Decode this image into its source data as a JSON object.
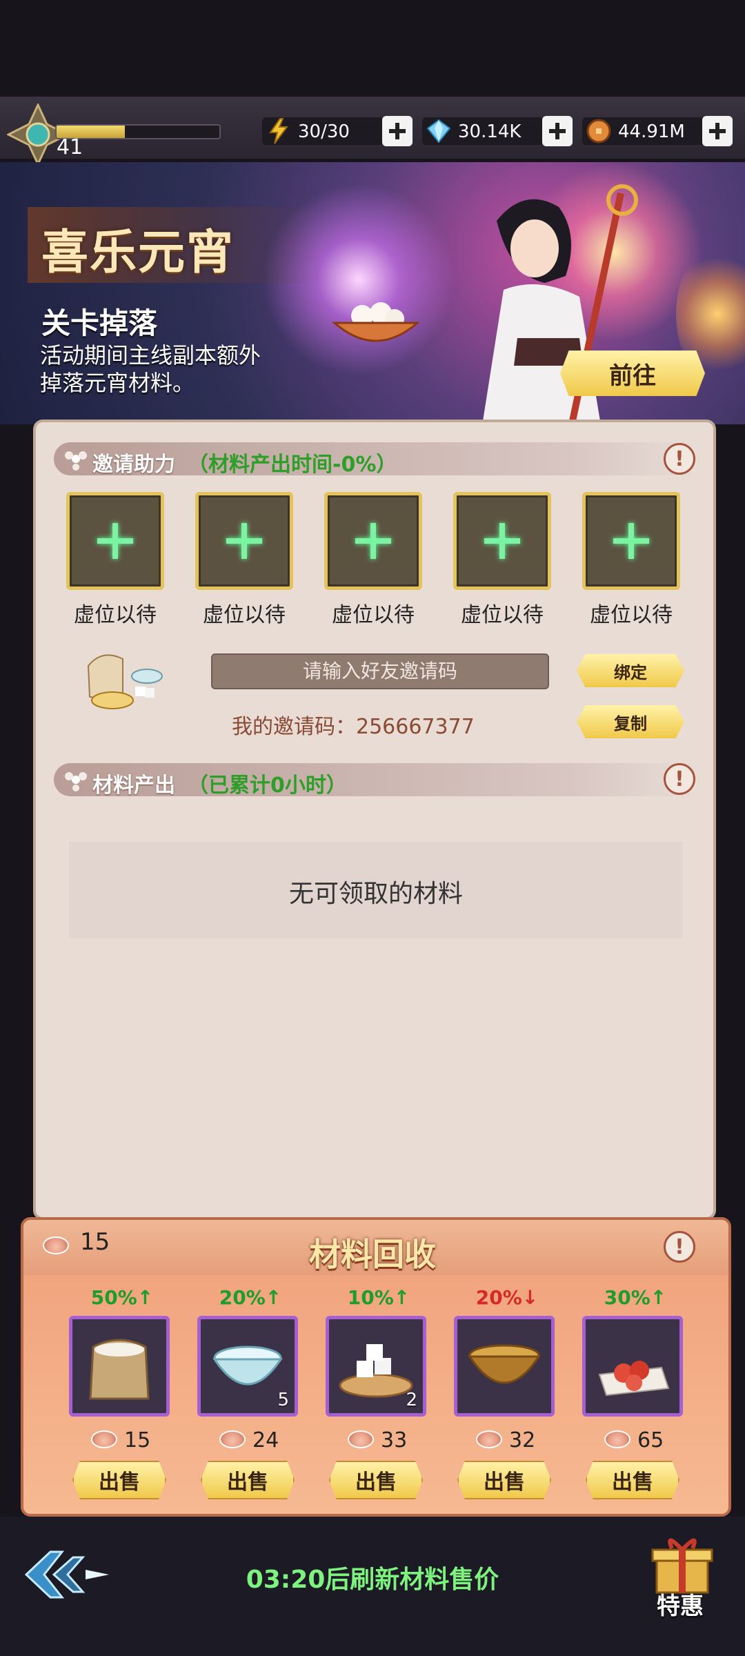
{
  "header": {
    "level": "41",
    "xp_fraction": 0.42,
    "energy": "30/30",
    "gems": "30.14K",
    "coins": "44.91M"
  },
  "banner": {
    "title": "喜乐元宵",
    "subtitle": "关卡掉落",
    "description": "活动期间主线副本额外掉落元宵材料。",
    "goto_label": "前往"
  },
  "invite": {
    "section_title": "邀请助力",
    "section_hint": "（材料产出时间-0%）",
    "slots": [
      "虚位以待",
      "虚位以待",
      "虚位以待",
      "虚位以待",
      "虚位以待"
    ],
    "input_placeholder": "请输入好友邀请码",
    "bind_label": "绑定",
    "copy_label": "复制",
    "my_code": "我的邀请码：256667377"
  },
  "output": {
    "section_title": "材料产出",
    "section_hint": "（已累计0小时）",
    "empty_text": "无可领取的材料"
  },
  "recycle": {
    "title": "材料回收",
    "currency_count": "15",
    "sell_label": "出售",
    "items": [
      {
        "name": "flour-sack",
        "rate": "50%↑",
        "trend": "up",
        "qty": "",
        "price": "15"
      },
      {
        "name": "water-bowl",
        "rate": "20%↑",
        "trend": "up",
        "qty": "5",
        "price": "24"
      },
      {
        "name": "sugar-cubes",
        "rate": "10%↑",
        "trend": "up",
        "qty": "2",
        "price": "33"
      },
      {
        "name": "sesame-bowl",
        "rate": "20%↓",
        "trend": "down",
        "qty": "",
        "price": "32"
      },
      {
        "name": "hawthorn-tray",
        "rate": "30%↑",
        "trend": "up",
        "qty": "",
        "price": "65"
      }
    ]
  },
  "footer": {
    "refresh_text": "03:20后刷新材料售价",
    "special_label": "特惠"
  }
}
